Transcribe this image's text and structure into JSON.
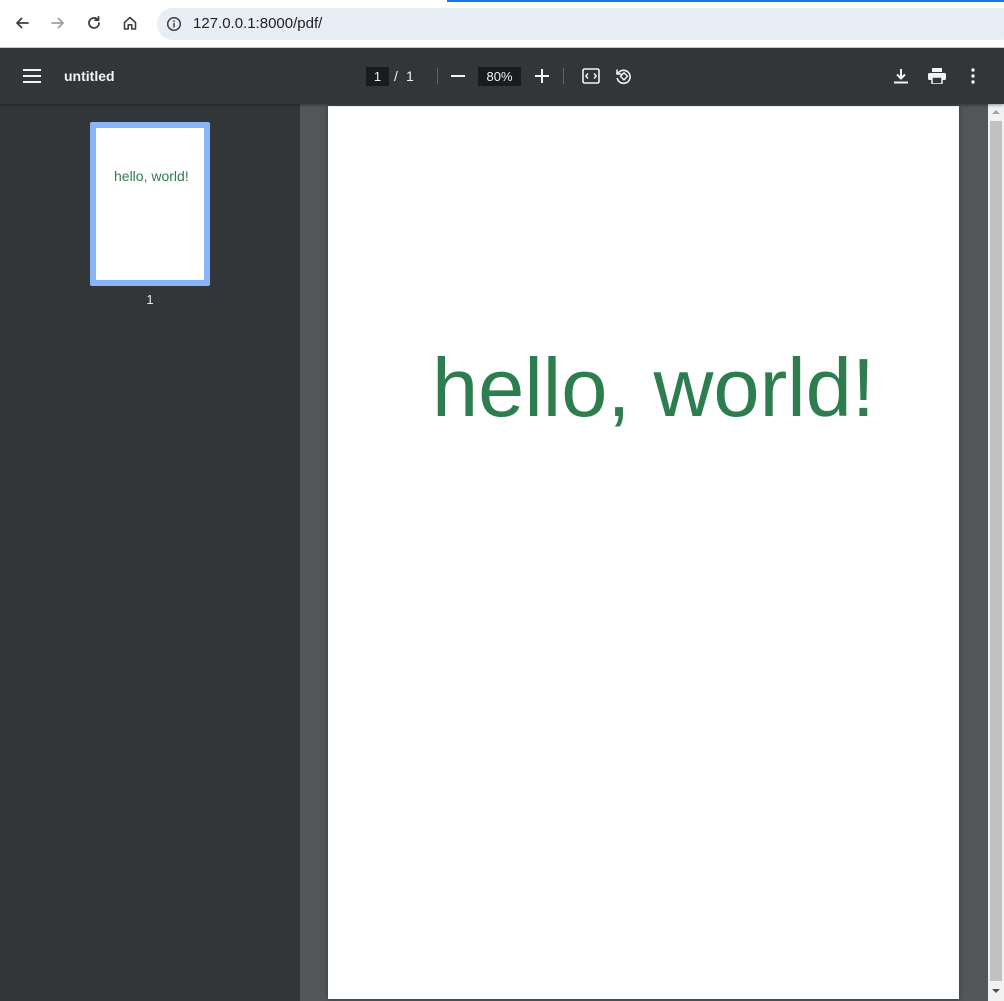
{
  "browser": {
    "url": "127.0.0.1:8000/pdf/",
    "icons": [
      "back-icon",
      "forward-icon",
      "reload-icon",
      "home-icon",
      "info-icon"
    ]
  },
  "toolbar": {
    "title": "untitled",
    "current_page": "1",
    "page_separator": "/",
    "total_pages": "1",
    "zoom": "80%",
    "icons": [
      "menu-icon",
      "zoom-out-icon",
      "zoom-in-icon",
      "fit-page-icon",
      "rotate-icon",
      "download-icon",
      "print-icon",
      "more-options-icon"
    ]
  },
  "sidebar": {
    "thumbnails": [
      {
        "text": "hello, world!",
        "label": "1"
      }
    ]
  },
  "document": {
    "pages": [
      {
        "text": "hello, world!"
      }
    ],
    "text_color": "#2e7d4f"
  },
  "colors": {
    "toolbar_bg": "#323639",
    "viewer_bg": "#525659",
    "thumb_selected_border": "#8ab4f8",
    "accent": "#1a73e8"
  }
}
